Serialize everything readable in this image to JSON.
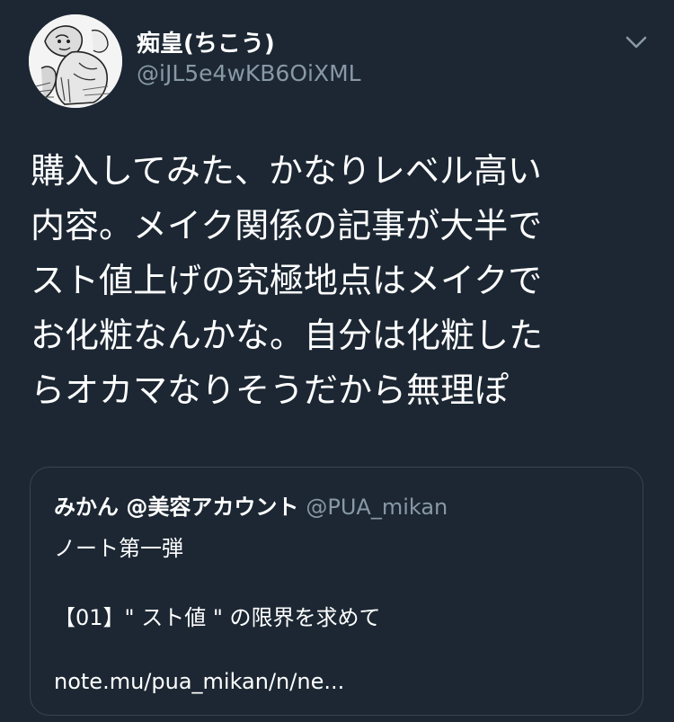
{
  "author": {
    "display_name": "痴皇(ちこう)",
    "handle": "@iJL5e4wKB6OiXML",
    "avatar_icon": "manga-wrestler-avatar-icon"
  },
  "menu": {
    "icon": "chevron-down-icon"
  },
  "tweet": {
    "lines": [
      "購入してみた、かなりレベル高い",
      "内容。メイク関係の記事が大半で",
      "スト値上げの究極地点はメイクで",
      "お化粧なんかな。自分は化粧した",
      "らオカマなりそうだから無理ぽ"
    ]
  },
  "quoted_tweet": {
    "display_name": "みかん @美容アカウント",
    "handle": "@PUA_mikan",
    "lines": [
      "ノート第一弾",
      "【01】\" スト値 \" の限界を求めて",
      "note.mu/pua_mikan/n/ne..."
    ]
  },
  "colors": {
    "background": "#1c2733",
    "primary_text": "#ffffff",
    "secondary_text": "#8899a6",
    "border": "#38444d"
  }
}
